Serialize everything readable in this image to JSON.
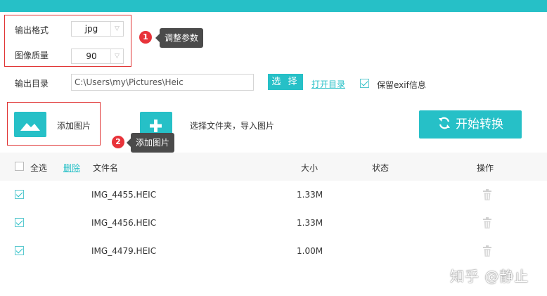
{
  "settings": {
    "format_label": "输出格式",
    "format_value": "jpg",
    "quality_label": "图像质量",
    "quality_value": "90",
    "output_dir_label": "输出目录",
    "output_dir_value": "C:\\Users\\my\\Pictures\\Heic",
    "choose_button": "选 择",
    "open_dir_link": "打开目录",
    "keep_exif_label": "保留exif信息",
    "keep_exif_checked": true
  },
  "callouts": [
    {
      "number": "1",
      "text": "调整参数"
    },
    {
      "number": "2",
      "text": "添加图片"
    }
  ],
  "toolbar": {
    "add_image_label": "添加图片",
    "add_folder_label": "选择文件夹，导入图片",
    "start_button": "开始转换"
  },
  "table": {
    "select_all": "全选",
    "delete": "删除",
    "columns": [
      "文件名",
      "大小",
      "状态",
      "操作"
    ],
    "rows": [
      {
        "name": "IMG_4455.HEIC",
        "size": "1.33M",
        "status": "",
        "checked": true
      },
      {
        "name": "IMG_4456.HEIC",
        "size": "1.33M",
        "status": "",
        "checked": true
      },
      {
        "name": "IMG_4479.HEIC",
        "size": "1.00M",
        "status": "",
        "checked": true
      }
    ]
  },
  "watermark": "知乎 @静止",
  "colors": {
    "accent": "#26c0c7",
    "highlight": "#e03434",
    "tooltip": "#4b4b4b"
  }
}
